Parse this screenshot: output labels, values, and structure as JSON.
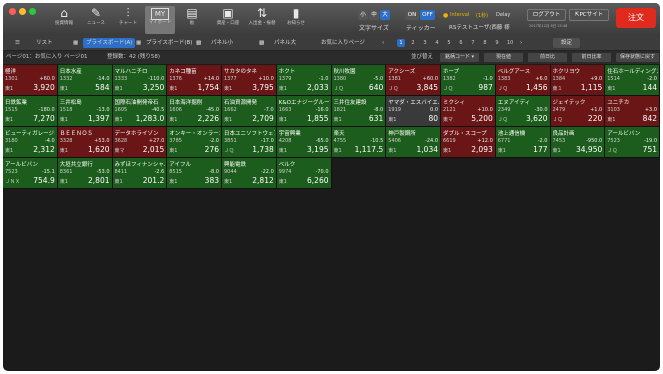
{
  "toolbar": {
    "buttons": [
      {
        "name": "portfolio",
        "icon": "⌂",
        "label": "投資情報"
      },
      {
        "name": "news",
        "icon": "✎",
        "label": "ニュース"
      },
      {
        "name": "chart",
        "icon": "⫶",
        "label": "チャート"
      },
      {
        "name": "mypage",
        "icon": "MY",
        "label": "マイボード"
      },
      {
        "name": "board",
        "icon": "▤",
        "label": "板"
      },
      {
        "name": "asset",
        "icon": "▣",
        "label": "資産・口座"
      },
      {
        "name": "deposit",
        "icon": "⇅",
        "label": "入出金・振替"
      },
      {
        "name": "notice",
        "icon": "▮",
        "label": "お知らせ"
      }
    ],
    "font_sizes": [
      "小",
      "中",
      "大"
    ],
    "font_size_label": "文字サイズ",
    "on": "ON",
    "off": "OFF",
    "ticker_label": "ティッカー",
    "interval": "Interval",
    "interval_secs": "(1秒)",
    "delay": "Delay",
    "account": "RSテストユーザ(西藤 様",
    "last_login": "2017年12月 8日 15:48",
    "logout": "ログアウト",
    "pc_site": "PCサイト",
    "order": "注文"
  },
  "toolbar2": {
    "list": "リスト",
    "price_board": "プライスボード(A)",
    "price_board_b": "プライスボード(B)",
    "panel_small": "パネル小",
    "panel_large": "パネル大",
    "favorite_page": "お気に入りページ",
    "pages": [
      "1",
      "2",
      "3",
      "4",
      "5",
      "6",
      "7",
      "8",
      "9",
      "10"
    ],
    "setup": "設定"
  },
  "row3": {
    "page_info": "ページ01：お気に入り ページ01",
    "count": "登録数：42 (残り58)",
    "sort_label": "並び替え",
    "sort_value": "銘柄コード",
    "btns": [
      "現在値",
      "前日比",
      "前日比率",
      "保存状態に戻す"
    ]
  },
  "stocks": [
    {
      "name": "極洋",
      "code": "1301",
      "market": "東1",
      "change": "+60.0",
      "price": "3,920",
      "color": "red"
    },
    {
      "name": "日本水産",
      "code": "1332",
      "market": "東1",
      "change": "-14.0",
      "price": "584",
      "color": "green"
    },
    {
      "name": "マルハニチロ",
      "code": "1333",
      "market": "東1",
      "change": "-110.0",
      "price": "3,250",
      "color": "green"
    },
    {
      "name": "カネコ種苗",
      "code": "1376",
      "market": "東1",
      "change": "+14.0",
      "price": "1,754",
      "color": "red"
    },
    {
      "name": "サカタのタネ",
      "code": "1377",
      "market": "東1",
      "change": "+10.0",
      "price": "3,795",
      "color": "red"
    },
    {
      "name": "ホクト",
      "code": "1379",
      "market": "東1",
      "change": "-1.0",
      "price": "2,033",
      "color": "green"
    },
    {
      "name": "秋川牧園",
      "code": "1380",
      "market": "ＪＱ",
      "change": "-5.0",
      "price": "640",
      "color": "green"
    },
    {
      "name": "アクシーズ",
      "code": "1381",
      "market": "ＪＱ",
      "change": "+60.0",
      "price": "3,845",
      "color": "red"
    },
    {
      "name": "ホープ",
      "code": "1382",
      "market": "ＪＱ",
      "change": "-1.0",
      "price": "987",
      "color": "green"
    },
    {
      "name": "ベルグアース",
      "code": "1383",
      "market": "ＪＱ",
      "change": "+6.0",
      "price": "1,456",
      "color": "red"
    },
    {
      "name": "ホクリヨウ",
      "code": "1384",
      "market": "東１",
      "change": "+9.0",
      "price": "1,115",
      "color": "red"
    },
    {
      "name": "住石ホールディングス",
      "code": "1514",
      "market": "東1",
      "change": "-2.0",
      "price": "144",
      "color": "green"
    },
    {
      "name": "日鉄鉱業",
      "code": "1515",
      "market": "東1",
      "change": "-180.0",
      "price": "7,270",
      "color": "green"
    },
    {
      "name": "三井松島",
      "code": "1518",
      "market": "東1",
      "change": "-13.0",
      "price": "1,397",
      "color": "green"
    },
    {
      "name": "国際石油開発帝石",
      "code": "1605",
      "market": "東1",
      "change": "-40.5",
      "price": "1,283.0",
      "color": "green"
    },
    {
      "name": "日本海洋掘削",
      "code": "1606",
      "market": "東1",
      "change": "-45.0",
      "price": "2,226",
      "color": "green"
    },
    {
      "name": "石油資源開発",
      "code": "1662",
      "market": "東1",
      "change": "-7.0",
      "price": "2,709",
      "color": "green"
    },
    {
      "name": "K&Oエナジーグループ",
      "code": "1663",
      "market": "東1",
      "change": "-16.0",
      "price": "1,855",
      "color": "green"
    },
    {
      "name": "三井住友建設",
      "code": "1821",
      "market": "東1",
      "change": "-8.0",
      "price": "631",
      "color": "green"
    },
    {
      "name": "ヤマダ・エスバイエル",
      "code": "1919",
      "market": "東1",
      "change": "0.0",
      "price": "80",
      "color": "grey"
    },
    {
      "name": "ミクシィ",
      "code": "2121",
      "market": "東マ",
      "change": "+10.0",
      "price": "5,200",
      "color": "red"
    },
    {
      "name": "エヌアイディ",
      "code": "2349",
      "market": "ＪＱ",
      "change": "-30.0",
      "price": "3,620",
      "color": "green"
    },
    {
      "name": "ジェイテック",
      "code": "2479",
      "market": "ＪＱ",
      "change": "+1.0",
      "price": "220",
      "color": "red"
    },
    {
      "name": "ユニチカ",
      "code": "3103",
      "market": "東1",
      "change": "+3.0",
      "price": "842",
      "color": "red"
    },
    {
      "name": "ビューティガレージ",
      "code": "3180",
      "market": "東1",
      "change": "-4.0",
      "price": "2,312",
      "color": "green"
    },
    {
      "name": "ＢＥＥＮＯＳ",
      "code": "3328",
      "market": "東1",
      "change": "+53.0",
      "price": "1,620",
      "color": "red"
    },
    {
      "name": "データホライゾン",
      "code": "3628",
      "market": "東マ",
      "change": "+27.0",
      "price": "2,015",
      "color": "red"
    },
    {
      "name": "オンキー・オンラーン",
      "code": "3785",
      "market": "東1",
      "change": "-2.0",
      "price": "276",
      "color": "green"
    },
    {
      "name": "日本ユニソフトウェア",
      "code": "3851",
      "market": "ＪＱ",
      "change": "-17.0",
      "price": "1,738",
      "color": "green"
    },
    {
      "name": "宇宙興業",
      "code": "4208",
      "market": "東1",
      "change": "-65.0",
      "price": "3,195",
      "color": "green"
    },
    {
      "name": "楽天",
      "code": "4755",
      "market": "東1",
      "change": "-10.5",
      "price": "1,117.5",
      "color": "green"
    },
    {
      "name": "神戸製鋼所",
      "code": "5406",
      "market": "東1",
      "change": "-24.0",
      "price": "1,034",
      "color": "green"
    },
    {
      "name": "ダブル・スコープ",
      "code": "6619",
      "market": "東1",
      "change": "+12.0",
      "price": "2,093",
      "color": "red"
    },
    {
      "name": "池上通信機",
      "code": "6771",
      "market": "東1",
      "change": "-2.0",
      "price": "177",
      "color": "green"
    },
    {
      "name": "良品計画",
      "code": "7453",
      "market": "東1",
      "change": "-950.0",
      "price": "34,950",
      "color": "green"
    },
    {
      "name": "アールビバン",
      "code": "7523",
      "market": "ＪＱ",
      "change": "-19.0",
      "price": "751",
      "color": "green"
    },
    {
      "name": "アールビバン",
      "code": "7523",
      "market": "ＪＮＸ",
      "change": "-15.1",
      "price": "754.9",
      "color": "green"
    },
    {
      "name": "大垣共立銀行",
      "code": "8361",
      "market": "東1",
      "change": "-53.0",
      "price": "2,801",
      "color": "green"
    },
    {
      "name": "みずほフィナンシャル",
      "code": "8411",
      "market": "東1",
      "change": "-2.6",
      "price": "201.2",
      "color": "green"
    },
    {
      "name": "アイフル",
      "code": "8515",
      "market": "東1",
      "change": "-8.0",
      "price": "383",
      "color": "green"
    },
    {
      "name": "興能電鉄",
      "code": "9044",
      "market": "東1",
      "change": "-22.0",
      "price": "2,812",
      "color": "green"
    },
    {
      "name": "ベルク",
      "code": "9974",
      "market": "東1",
      "change": "-70.0",
      "price": "6,260",
      "color": "green"
    }
  ]
}
